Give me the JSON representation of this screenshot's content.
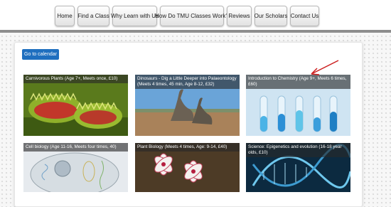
{
  "nav": {
    "items": [
      {
        "label": "Home"
      },
      {
        "label": "Find a Class"
      },
      {
        "label": "Why Learn with Us"
      },
      {
        "label": "How Do TMU Classes Work?"
      },
      {
        "label": "Reviews"
      },
      {
        "label": "Our Scholars"
      },
      {
        "label": "Contact Us"
      }
    ]
  },
  "main": {
    "calendar_button": "Go to calendar",
    "cards": [
      {
        "caption": "Carnivorous Plants (Age 7+, Meets once, £10)",
        "image_icon": "venus-flytrap-image"
      },
      {
        "caption": "Dinosaurs - Dig a Little Deeper into Palaeontology (Meets 4 times, 45 min, Age 8-12, £32)",
        "image_icon": "dinosaur-image"
      },
      {
        "caption": "Introduction to Chemistry (Age 9+, Meets 6 times, £60)",
        "image_icon": "test-tubes-image"
      },
      {
        "caption": "Cell biology (Age 11-16, Meets four times, 40)",
        "image_icon": "cell-diagram-image"
      },
      {
        "caption": "Plant Biology (Meets 4 times, Age: 9-14, £40)",
        "image_icon": "flower-image"
      },
      {
        "caption": "Science: Epigenetics and evolution (16-18 year olds, £10)",
        "image_icon": "dna-helix-image"
      }
    ]
  },
  "colors": {
    "accent": "#1f6fbf",
    "annotation_arrow": "#cc1f1f"
  }
}
